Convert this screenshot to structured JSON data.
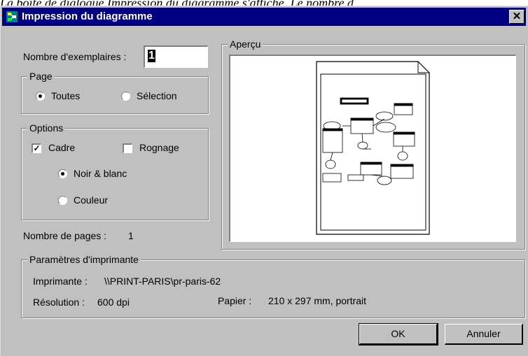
{
  "caption": "La boîte de dialogue Impression du diagramme s'affiche. Le nombre d",
  "window": {
    "title": "Impression du diagramme",
    "close_glyph": "✕"
  },
  "copies": {
    "label": "Nombre d'exemplaires :",
    "value": "1"
  },
  "page_group": {
    "legend": "Page",
    "options": [
      {
        "label": "Toutes",
        "selected": true
      },
      {
        "label": "Sélection",
        "selected": false
      }
    ]
  },
  "options_group": {
    "legend": "Options",
    "cadre": {
      "label": "Cadre",
      "checked": true
    },
    "rognage": {
      "label": "Rognage",
      "checked": false
    },
    "color_modes": [
      {
        "label": "Noir & blanc",
        "selected": true
      },
      {
        "label": "Couleur",
        "selected": false
      }
    ]
  },
  "page_count": {
    "label": "Nombre de pages :",
    "value": "1"
  },
  "preview": {
    "legend": "Aperçu"
  },
  "printer_params": {
    "legend": "Paramètres d'imprimante",
    "printer_label": "Imprimante :",
    "printer_value": "\\\\PRINT-PARIS\\pr-paris-62",
    "resolution_label": "Résolution :",
    "resolution_value": "600 dpi",
    "paper_label": "Papier :",
    "paper_value": "210 x 297 mm, portrait"
  },
  "buttons": {
    "ok": "OK",
    "cancel": "Annuler"
  },
  "colors": {
    "titlebar": "#000080",
    "face": "#c0c0c0"
  }
}
